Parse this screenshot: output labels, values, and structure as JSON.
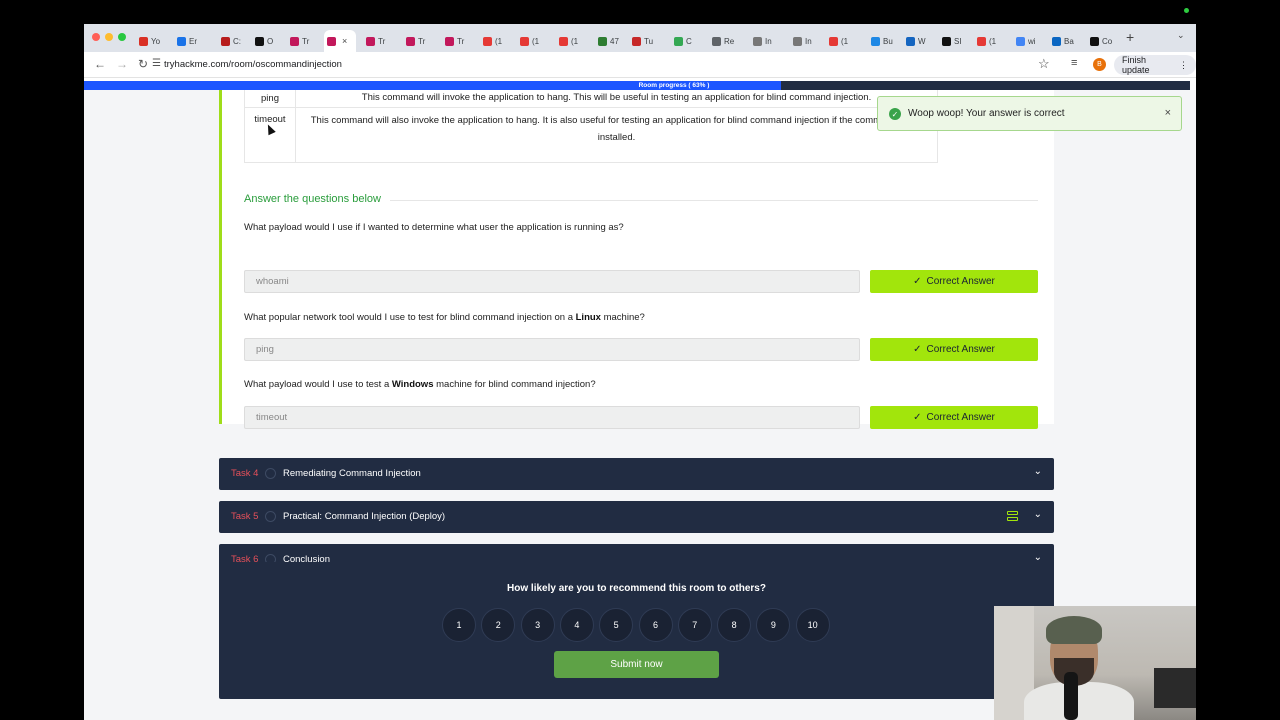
{
  "browser": {
    "tabs": [
      {
        "label": "Yo",
        "color": "#d93025"
      },
      {
        "label": "Er",
        "color": "#1a73e8"
      },
      {
        "label": "C:",
        "color": "#b71c1c"
      },
      {
        "label": "O",
        "color": "#111111"
      },
      {
        "label": "Tr",
        "color": "#c2185b"
      },
      {
        "label": "",
        "color": "#c2185b"
      },
      {
        "label": "Tr",
        "color": "#c2185b"
      },
      {
        "label": "Tr",
        "color": "#c2185b"
      },
      {
        "label": "Tr",
        "color": "#c2185b"
      },
      {
        "label": "(1",
        "color": "#e53935"
      },
      {
        "label": "(1",
        "color": "#e53935"
      },
      {
        "label": "(1",
        "color": "#e53935"
      },
      {
        "label": "47",
        "color": "#2e7d32"
      },
      {
        "label": "Tu",
        "color": "#c62828"
      },
      {
        "label": "C",
        "color": "#34a853"
      },
      {
        "label": "Re",
        "color": "#5f6368"
      },
      {
        "label": "In",
        "color": "#777777"
      },
      {
        "label": "In",
        "color": "#777777"
      },
      {
        "label": "(1",
        "color": "#e53935"
      },
      {
        "label": "Bu",
        "color": "#1e88e5"
      },
      {
        "label": "W",
        "color": "#1565c0"
      },
      {
        "label": "SI",
        "color": "#111111"
      },
      {
        "label": "(1",
        "color": "#e53935"
      },
      {
        "label": "wi",
        "color": "#4285f4"
      },
      {
        "label": "Ba",
        "color": "#0a66c2"
      },
      {
        "label": "Co",
        "color": "#111111"
      }
    ],
    "url": "tryhackme.com/room/oscommandinjection",
    "finish_update_label": "Finish update",
    "avatar_letter": "B"
  },
  "progress": {
    "label": "Room progress ( 63% )",
    "percent": 63
  },
  "table": {
    "rows": [
      {
        "command": "ping",
        "description": "This command will invoke the application to hang. This will be useful in testing an application for blind command injection."
      },
      {
        "command": "timeout",
        "description": "This command will also invoke the application to hang. It is also useful for testing an application for blind command injection if the command is not installed."
      }
    ]
  },
  "questions_section": {
    "title": "Answer the questions below",
    "questions": [
      {
        "pre": "What payload would I use if I wanted to determine what user the application is running as?",
        "bold": "",
        "post": "",
        "answer": "whoami",
        "button": "Correct Answer"
      },
      {
        "pre": "What popular network tool would I use to test for blind command injection on a ",
        "bold": "Linux",
        "post": " machine?",
        "answer": "ping",
        "button": "Correct Answer"
      },
      {
        "pre": "What payload would I use to test a ",
        "bold": "Windows",
        "post": " machine for blind command injection?",
        "answer": "timeout",
        "button": "Correct Answer"
      }
    ]
  },
  "tasks": [
    {
      "num": "Task 4",
      "title": "Remediating Command Injection",
      "deploy": false
    },
    {
      "num": "Task 5",
      "title": "Practical: Command Injection (Deploy)",
      "deploy": true
    },
    {
      "num": "Task 6",
      "title": "Conclusion",
      "deploy": false
    }
  ],
  "survey": {
    "question": "How likely are you to recommend this room to others?",
    "options": [
      "1",
      "2",
      "3",
      "4",
      "5",
      "6",
      "7",
      "8",
      "9",
      "10"
    ],
    "submit_label": "Submit now"
  },
  "toast": {
    "message": "Woop woop! Your answer is correct"
  },
  "colors": {
    "accent_green": "#a2e50c",
    "task_bar": "#212c42",
    "task_number": "#e7505a",
    "progress_fill": "#1c56ff"
  }
}
